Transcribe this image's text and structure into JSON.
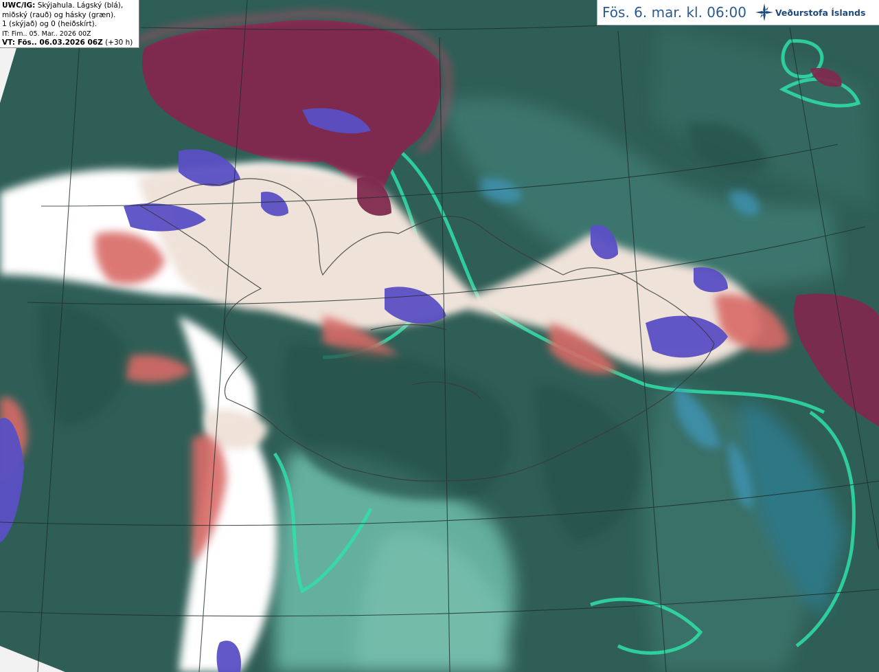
{
  "legend": {
    "code": "UWC/IG:",
    "description_1": "Skýjahula. Lágský (blá),",
    "description_2": "miðský (rauð) og hásky (græn).",
    "description_3": "1 (skýjað) og 0 (heiðskírt).",
    "initial_time": "IT: Fim.. 05. Mar.. 2026 00Z",
    "valid_time_label": "VT: Fös.. 06.03.2026 06Z",
    "lead_time": "(+30 h)"
  },
  "header": {
    "valid_time": "Fös. 6. mar. kl. 06:00",
    "logo_text": "Veðurstofa Íslands",
    "logo_icon": "vedurstofa-logo-icon"
  },
  "map": {
    "region": "Iceland and surrounding seas",
    "colors": {
      "background_dark": "#2f5e56",
      "high_cloud": "#2fe0a8",
      "mid_cloud": "#d86a66",
      "low_cloud": "#5a4fc4",
      "overcast": "#7e2a4e",
      "clear_land": "#efe2d9",
      "white": "#ffffff",
      "light_teal": "#6ab8a6"
    }
  }
}
